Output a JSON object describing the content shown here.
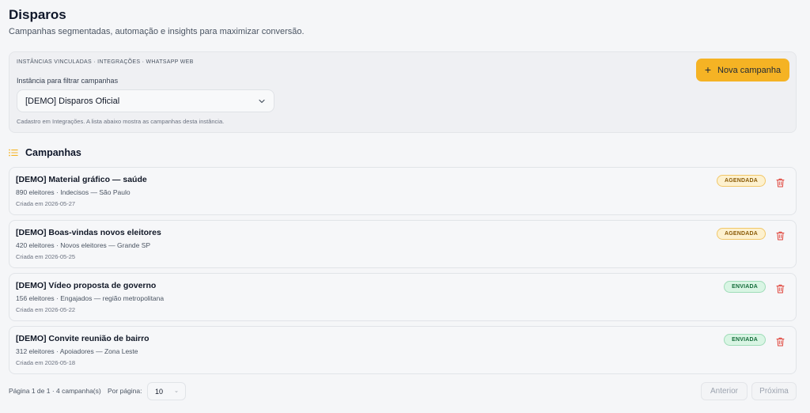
{
  "header": {
    "title": "Disparos",
    "subtitle": "Campanhas segmentadas, automação e insights para maximizar conversão."
  },
  "filter": {
    "eyebrow": "INSTÂNCIAS VINCULADAS · INTEGRAÇÕES · WHATSAPP WEB",
    "label": "Instância para filtrar campanhas",
    "selected": "[DEMO] Disparos Oficial",
    "help": "Cadastro em Integrações. A lista abaixo mostra as campanhas desta instância.",
    "new_button": "Nova campanha"
  },
  "section": {
    "title": "Campanhas"
  },
  "campaigns": [
    {
      "title": "[DEMO] Material gráfico — saúde",
      "meta": "890 eleitores · Indecisos — São Paulo",
      "date": "Criada em 2026-05-27",
      "status": "AGENDADA"
    },
    {
      "title": "[DEMO] Boas-vindas novos eleitores",
      "meta": "420 eleitores · Novos eleitores — Grande SP",
      "date": "Criada em 2026-05-25",
      "status": "AGENDADA"
    },
    {
      "title": "[DEMO] Vídeo proposta de governo",
      "meta": "156 eleitores · Engajados — região metropolitana",
      "date": "Criada em 2026-05-22",
      "status": "ENVIADA"
    },
    {
      "title": "[DEMO] Convite reunião de bairro",
      "meta": "312 eleitores · Apoiadores — Zona Leste",
      "date": "Criada em 2026-05-18",
      "status": "ENVIADA"
    }
  ],
  "pagination": {
    "info": "Página 1 de 1 · 4 campanha(s)",
    "per_page_label": "Por página:",
    "per_page_value": "10",
    "prev": "Anterior",
    "next": "Próxima"
  },
  "colors": {
    "accent": "#f5b324",
    "agendada": "#fdf1cf",
    "enviada": "#d9f5e4",
    "danger": "#e0463d"
  },
  "icons": {
    "new_button": "plus-icon",
    "section": "list-icon",
    "select": "chevron-down-icon",
    "delete": "trash-icon"
  }
}
